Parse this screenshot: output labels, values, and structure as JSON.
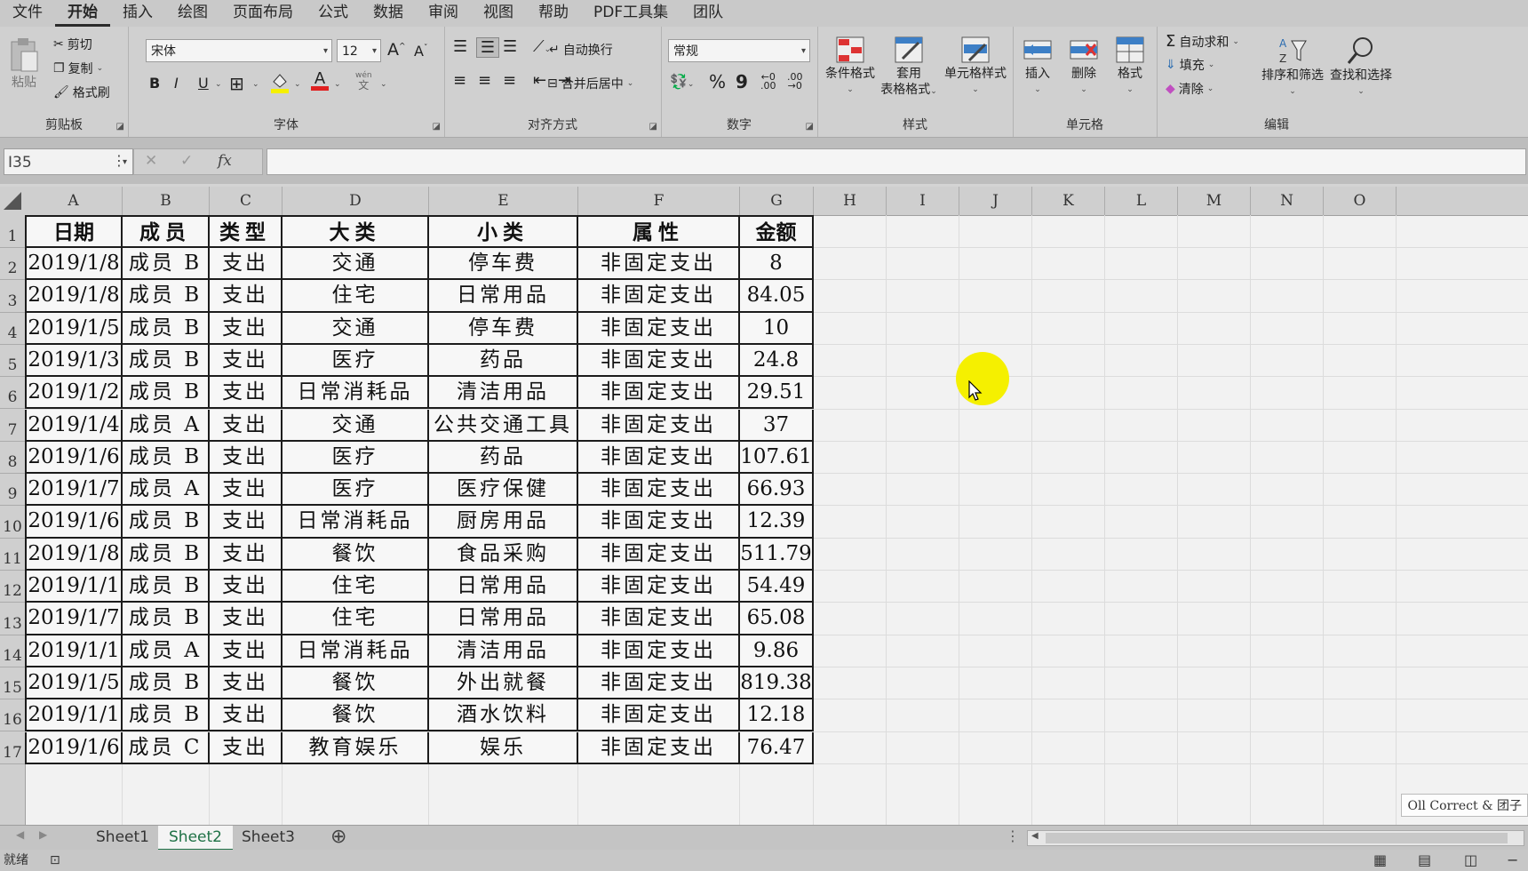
{
  "menu": {
    "tabs": [
      "文件",
      "开始",
      "插入",
      "绘图",
      "页面布局",
      "公式",
      "数据",
      "审阅",
      "视图",
      "帮助",
      "PDF工具集",
      "团队"
    ]
  },
  "ribbon": {
    "clipboard": {
      "label": "剪贴板",
      "paste": "粘贴",
      "cut": "剪切",
      "copy": "复制",
      "format_painter": "格式刷"
    },
    "font": {
      "label": "字体",
      "font_name": "宋体",
      "font_size": "12",
      "grow": "A",
      "shrink": "A",
      "bold": "B",
      "italic": "I",
      "underline": "U",
      "color_letter": "A",
      "phonetic_top": "wén",
      "phonetic_bottom": "文"
    },
    "alignment": {
      "label": "对齐方式",
      "wrap": "自动换行",
      "merge": "合并后居中"
    },
    "number": {
      "label": "数字",
      "format": "常规",
      "percent": "%",
      "comma": "9"
    },
    "styles": {
      "label": "样式",
      "cond_format": "条件格式",
      "table_format_1": "套用",
      "table_format_2": "表格格式",
      "cell_styles": "单元格样式"
    },
    "cells": {
      "label": "单元格",
      "insert": "插入",
      "delete": "删除",
      "format": "格式"
    },
    "editing": {
      "label": "编辑",
      "autosum": "自动求和",
      "fill": "填充",
      "clear": "清除",
      "sort_filter": "排序和筛选",
      "find_select": "查找和选择"
    }
  },
  "formula_bar": {
    "name_box": "I35",
    "fx": "fx",
    "cancel": "✕",
    "enter": "✓",
    "value": ""
  },
  "columns": [
    "A",
    "B",
    "C",
    "D",
    "E",
    "F",
    "G",
    "H",
    "I",
    "J",
    "K",
    "L",
    "M",
    "N",
    "O"
  ],
  "rows": [
    "1",
    "2",
    "3",
    "4",
    "5",
    "6",
    "7",
    "8",
    "9",
    "10",
    "11",
    "12",
    "13",
    "14",
    "15",
    "16",
    "17"
  ],
  "table": {
    "headers": [
      "日期",
      "成员",
      "类型",
      "大类",
      "小类",
      "属性",
      "金额"
    ],
    "data": [
      [
        "2019/1/8",
        "成员 B",
        "支出",
        "交通",
        "停车费",
        "非固定支出",
        "8"
      ],
      [
        "2019/1/8",
        "成员 B",
        "支出",
        "住宅",
        "日常用品",
        "非固定支出",
        "84.05"
      ],
      [
        "2019/1/5",
        "成员 B",
        "支出",
        "交通",
        "停车费",
        "非固定支出",
        "10"
      ],
      [
        "2019/1/3",
        "成员 B",
        "支出",
        "医疗",
        "药品",
        "非固定支出",
        "24.8"
      ],
      [
        "2019/1/2",
        "成员 B",
        "支出",
        "日常消耗品",
        "清洁用品",
        "非固定支出",
        "29.51"
      ],
      [
        "2019/1/4",
        "成员 A",
        "支出",
        "交通",
        "公共交通工具",
        "非固定支出",
        "37"
      ],
      [
        "2019/1/6",
        "成员 B",
        "支出",
        "医疗",
        "药品",
        "非固定支出",
        "107.61"
      ],
      [
        "2019/1/7",
        "成员 A",
        "支出",
        "医疗",
        "医疗保健",
        "非固定支出",
        "66.93"
      ],
      [
        "2019/1/6",
        "成员 B",
        "支出",
        "日常消耗品",
        "厨房用品",
        "非固定支出",
        "12.39"
      ],
      [
        "2019/1/8",
        "成员 B",
        "支出",
        "餐饮",
        "食品采购",
        "非固定支出",
        "511.79"
      ],
      [
        "2019/1/1",
        "成员 B",
        "支出",
        "住宅",
        "日常用品",
        "非固定支出",
        "54.49"
      ],
      [
        "2019/1/7",
        "成员 B",
        "支出",
        "住宅",
        "日常用品",
        "非固定支出",
        "65.08"
      ],
      [
        "2019/1/1",
        "成员 A",
        "支出",
        "日常消耗品",
        "清洁用品",
        "非固定支出",
        "9.86"
      ],
      [
        "2019/1/5",
        "成员 B",
        "支出",
        "餐饮",
        "外出就餐",
        "非固定支出",
        "819.38"
      ],
      [
        "2019/1/1",
        "成员 B",
        "支出",
        "餐饮",
        "酒水饮料",
        "非固定支出",
        "12.18"
      ],
      [
        "2019/1/6",
        "成员 C",
        "支出",
        "教育娱乐",
        "娱乐",
        "非固定支出",
        "76.47"
      ]
    ]
  },
  "sheets": {
    "tabs": [
      "Sheet1",
      "Sheet2",
      "Sheet3"
    ],
    "active": "Sheet2",
    "add": "⊕"
  },
  "status": {
    "ready": "就绪",
    "corner_badge": "Oll Correct & 团子"
  },
  "colors": {
    "accent_green": "#1e7145",
    "cursor_highlight": "#f5f000"
  }
}
